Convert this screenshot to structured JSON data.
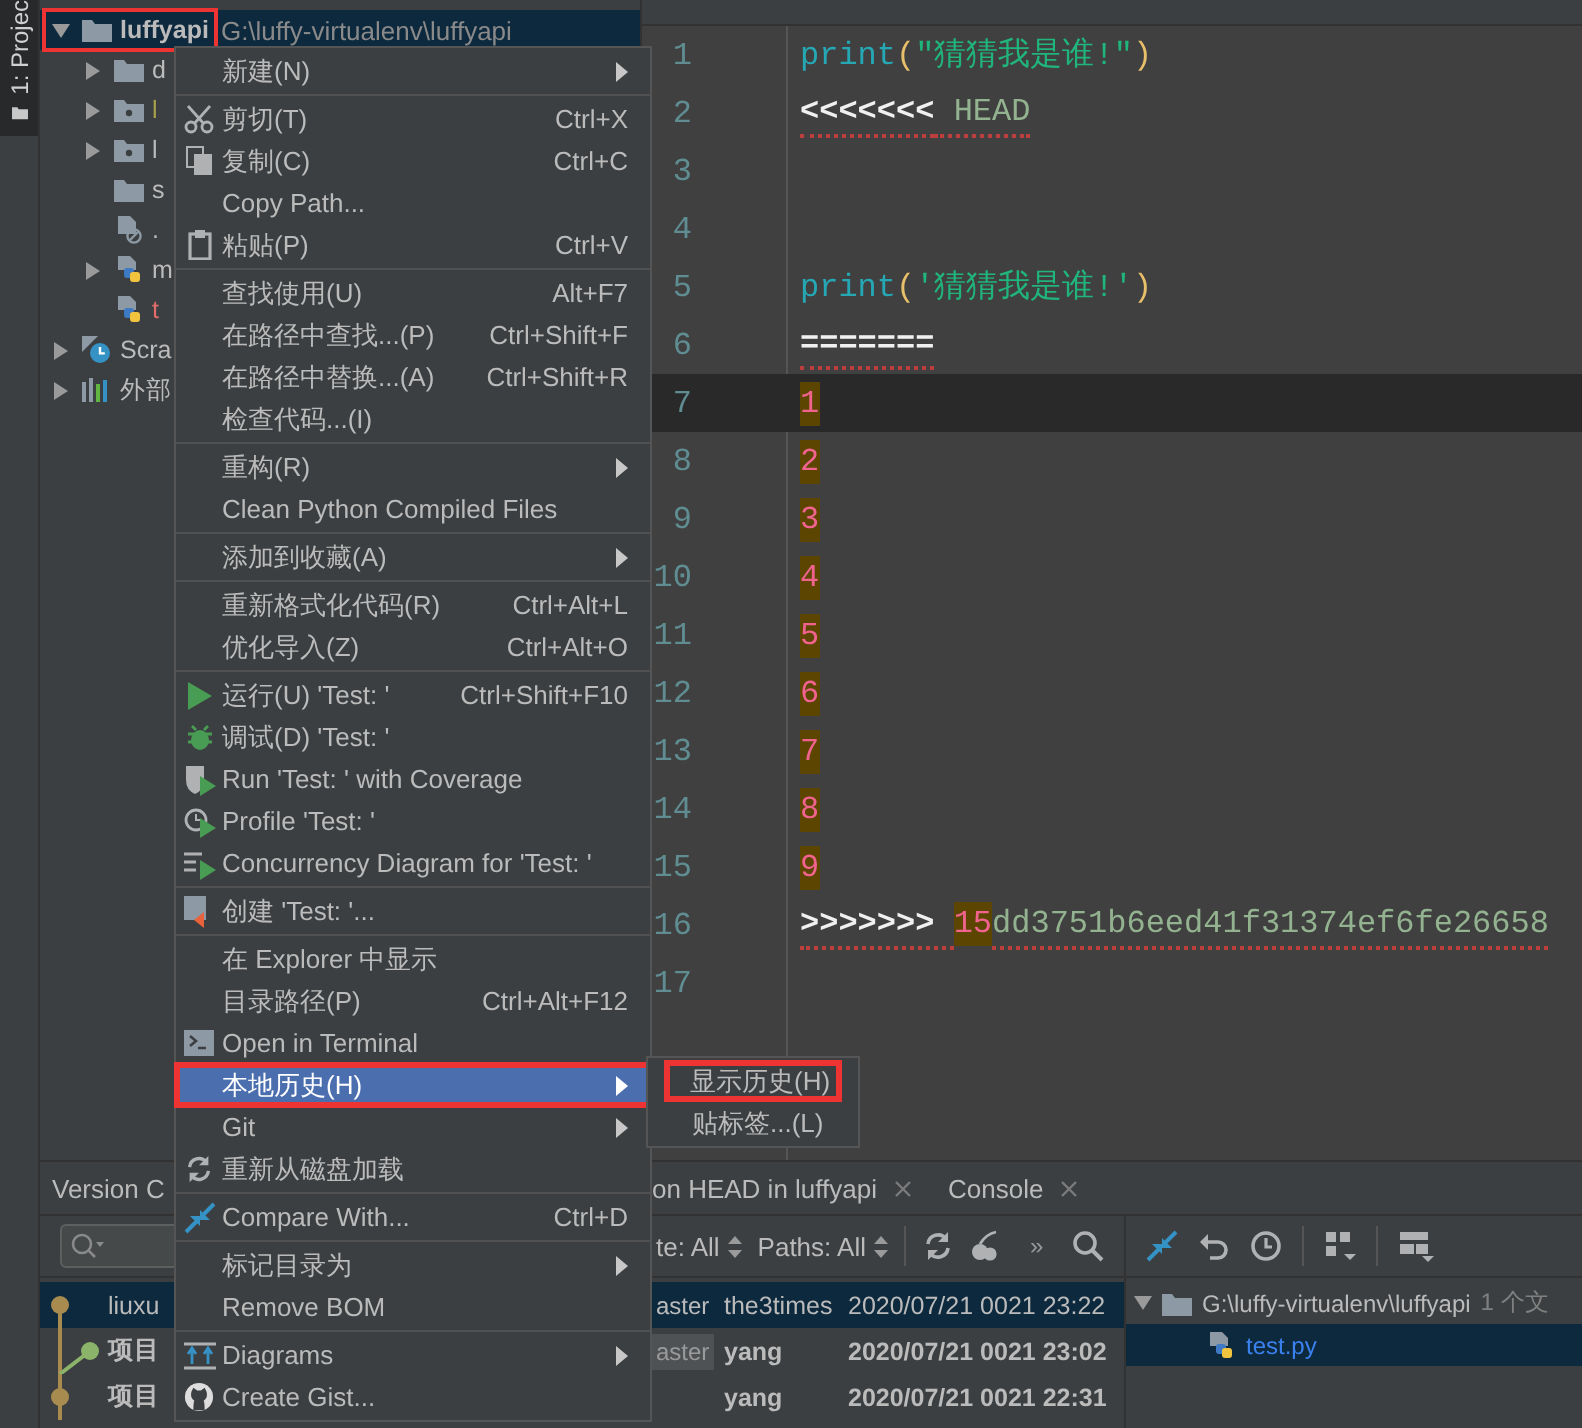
{
  "side_tab": {
    "label": "1: Projec",
    "selected": true
  },
  "project_tree": {
    "items": [
      {
        "label": "luffyapi",
        "path": "G:\\luffy-virtualenv\\luffyapi",
        "kind": "folder",
        "expanded": true,
        "selected": true,
        "annotated": true,
        "children": [
          {
            "label": "d",
            "kind": "folder",
            "expanded": false
          },
          {
            "label": "l",
            "kind": "package",
            "expanded": false,
            "color": "#a7a14c"
          },
          {
            "label": "l",
            "kind": "package",
            "expanded": false
          },
          {
            "label": "s",
            "kind": "folder"
          },
          {
            "label": ".",
            "kind": "ignore-file"
          },
          {
            "label": "m",
            "kind": "python",
            "expanded": false
          },
          {
            "label": "t",
            "kind": "python",
            "color": "#e06c6c"
          }
        ]
      },
      {
        "label": "Scra",
        "kind": "scratch",
        "expanded": false
      },
      {
        "label": "外部",
        "kind": "libraries",
        "expanded": false
      }
    ]
  },
  "editor": {
    "lines": [
      {
        "number": "1",
        "tokens": [
          {
            "text": "print",
            "kind": "builtin"
          },
          {
            "text": "(",
            "kind": "paren"
          },
          {
            "text": "\"猜猜我是谁!\"",
            "kind": "string"
          },
          {
            "text": ")",
            "kind": "paren"
          }
        ]
      },
      {
        "number": "2",
        "tokens": [
          {
            "text": "<<<<<<<",
            "kind": "marker",
            "error": true
          },
          {
            "text": " HEAD",
            "kind": "plain",
            "error": true
          }
        ]
      },
      {
        "number": "3"
      },
      {
        "number": "4"
      },
      {
        "number": "5",
        "tokens": [
          {
            "text": "print",
            "kind": "builtin"
          },
          {
            "text": "(",
            "kind": "paren"
          },
          {
            "text": "'猜猜我是谁!'",
            "kind": "string"
          },
          {
            "text": ")",
            "kind": "paren"
          }
        ]
      },
      {
        "number": "6",
        "tokens": [
          {
            "text": "=======",
            "kind": "marker",
            "error": true
          }
        ]
      },
      {
        "number": "7",
        "current": true,
        "tokens": [
          {
            "text": "1",
            "kind": "number",
            "highlight": true
          }
        ]
      },
      {
        "number": "8",
        "tokens": [
          {
            "text": "2",
            "kind": "number",
            "highlight": true
          }
        ]
      },
      {
        "number": "9",
        "tokens": [
          {
            "text": "3",
            "kind": "number",
            "highlight": true
          }
        ]
      },
      {
        "number": "10",
        "tokens": [
          {
            "text": "4",
            "kind": "number",
            "highlight": true
          }
        ]
      },
      {
        "number": "11",
        "tokens": [
          {
            "text": "5",
            "kind": "number",
            "highlight": true
          }
        ]
      },
      {
        "number": "12",
        "tokens": [
          {
            "text": "6",
            "kind": "number",
            "highlight": true
          }
        ]
      },
      {
        "number": "13",
        "tokens": [
          {
            "text": "7",
            "kind": "number",
            "highlight": true
          }
        ]
      },
      {
        "number": "14",
        "tokens": [
          {
            "text": "8",
            "kind": "number",
            "highlight": true
          }
        ]
      },
      {
        "number": "15",
        "tokens": [
          {
            "text": "9",
            "kind": "number",
            "highlight": true
          }
        ]
      },
      {
        "number": "16",
        "tokens": [
          {
            "text": ">>>>>>> ",
            "kind": "marker",
            "error": true
          },
          {
            "text": "15",
            "kind": "number",
            "highlight": true
          },
          {
            "text": "dd3751b6eed41f31374ef6fe26658",
            "kind": "plain",
            "error": true
          }
        ]
      },
      {
        "number": "17"
      }
    ]
  },
  "context_menu": {
    "items": [
      {
        "kind": "item",
        "label": "新建(N)",
        "submenu": true
      },
      {
        "kind": "separator"
      },
      {
        "kind": "item",
        "label": "剪切(T)",
        "shortcut": "Ctrl+X"
      },
      {
        "kind": "item",
        "label": "复制(C)",
        "shortcut": "Ctrl+C"
      },
      {
        "kind": "item",
        "label": "Copy Path..."
      },
      {
        "kind": "item",
        "label": "粘贴(P)",
        "shortcut": "Ctrl+V"
      },
      {
        "kind": "separator"
      },
      {
        "kind": "item",
        "label": "查找使用(U)",
        "shortcut": "Alt+F7"
      },
      {
        "kind": "item",
        "label": "在路径中查找...(P)",
        "shortcut": "Ctrl+Shift+F"
      },
      {
        "kind": "item",
        "label": "在路径中替换...(A)",
        "shortcut": "Ctrl+Shift+R"
      },
      {
        "kind": "item",
        "label": "检查代码...(I)"
      },
      {
        "kind": "separator"
      },
      {
        "kind": "item",
        "label": "重构(R)",
        "submenu": true
      },
      {
        "kind": "item",
        "label": "Clean Python Compiled Files"
      },
      {
        "kind": "separator"
      },
      {
        "kind": "item",
        "label": "添加到收藏(A)",
        "submenu": true
      },
      {
        "kind": "separator"
      },
      {
        "kind": "item",
        "label": "重新格式化代码(R)",
        "shortcut": "Ctrl+Alt+L"
      },
      {
        "kind": "item",
        "label": "优化导入(Z)",
        "shortcut": "Ctrl+Alt+O"
      },
      {
        "kind": "separator"
      },
      {
        "kind": "item",
        "label": "运行(U) 'Test: '",
        "shortcut": "Ctrl+Shift+F10"
      },
      {
        "kind": "item",
        "label": "调试(D) 'Test: '"
      },
      {
        "kind": "item",
        "label": "Run 'Test: ' with Coverage"
      },
      {
        "kind": "item",
        "label": "Profile 'Test: '"
      },
      {
        "kind": "item",
        "label": "Concurrency Diagram for 'Test: '"
      },
      {
        "kind": "separator"
      },
      {
        "kind": "item",
        "label": "创建 'Test: '..."
      },
      {
        "kind": "separator"
      },
      {
        "kind": "item",
        "label": "在 Explorer 中显示"
      },
      {
        "kind": "item",
        "label": "目录路径(P)",
        "shortcut": "Ctrl+Alt+F12"
      },
      {
        "kind": "item",
        "label": "Open in Terminal"
      },
      {
        "kind": "item",
        "label": "本地历史(H)",
        "submenu": true,
        "selected": true,
        "annotated": true
      },
      {
        "kind": "item",
        "label": "Git",
        "submenu": true
      },
      {
        "kind": "item",
        "label": "重新从磁盘加载"
      },
      {
        "kind": "separator"
      },
      {
        "kind": "item",
        "label": "Compare With...",
        "shortcut": "Ctrl+D"
      },
      {
        "kind": "separator"
      },
      {
        "kind": "item",
        "label": "标记目录为",
        "submenu": true
      },
      {
        "kind": "item",
        "label": "Remove BOM"
      },
      {
        "kind": "separator"
      },
      {
        "kind": "item",
        "label": "Diagrams",
        "submenu": true
      },
      {
        "kind": "item",
        "label": "Create Gist..."
      }
    ]
  },
  "submenu": {
    "items": [
      {
        "label": "显示历史(H)",
        "annotated": true
      },
      {
        "label": "贴标签...(L)",
        "annotated": false
      }
    ]
  },
  "bottom_panel": {
    "tabs": [
      {
        "label": "Version C"
      },
      {
        "label": "on HEAD in luffyapi",
        "closable": true
      },
      {
        "label": "Console",
        "closable": true
      }
    ],
    "filters": [
      {
        "label": "te: All"
      },
      {
        "label": "Paths: All"
      }
    ],
    "more": "»",
    "log_rows": [
      {
        "subject": "liuxu",
        "branch": "aster",
        "author": "the3times",
        "date": "2020/07/21 0021 23:22",
        "selected": true,
        "bold": false
      },
      {
        "subject": "项目",
        "branch": "aster",
        "author": "yang",
        "date": "2020/07/21 0021 23:02",
        "selected": false,
        "bold": true
      },
      {
        "subject": "项目",
        "author": "yang",
        "date": "2020/07/21 0021 22:31",
        "selected": false,
        "bold": true
      }
    ],
    "changes": [
      {
        "label": "G:\\luffy-virtualenv\\luffyapi",
        "note": "1 个文",
        "kind": "folder",
        "expanded": true,
        "selected": false,
        "children": [
          {
            "label": "test.py",
            "kind": "python",
            "selected": true
          }
        ]
      }
    ]
  }
}
